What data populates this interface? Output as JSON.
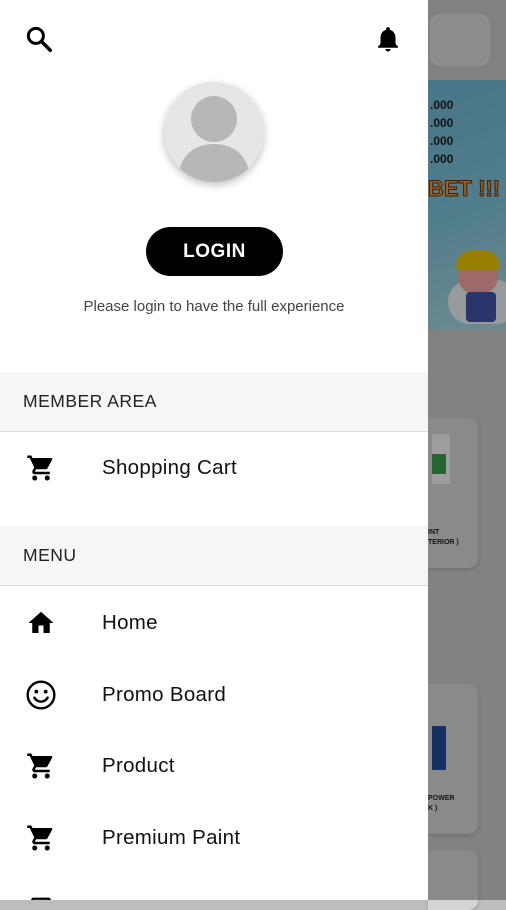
{
  "background": {
    "banner_numbers": [
      ".000",
      ".000",
      ".000",
      ".000"
    ],
    "banner_slogan": "BET !!!",
    "card1_title": "INT\nTERIOR )",
    "card2_title": "POWER\nK )"
  },
  "drawer": {
    "login_label": "LOGIN",
    "login_hint": "Please login to have the full experience",
    "member_section": {
      "title": "MEMBER AREA",
      "items": [
        {
          "label": "Shopping Cart",
          "icon": "cart-icon"
        }
      ]
    },
    "menu_section": {
      "title": "MENU",
      "items": [
        {
          "label": "Home",
          "icon": "home-icon"
        },
        {
          "label": "Promo Board",
          "icon": "smiley-icon"
        },
        {
          "label": "Product",
          "icon": "cart-icon"
        },
        {
          "label": "Premium Paint",
          "icon": "cart-icon"
        }
      ]
    }
  },
  "colors": {
    "accent": "#000000",
    "section_bg": "#f6f6f6",
    "scrim": "rgba(0,0,0,0.35)"
  }
}
